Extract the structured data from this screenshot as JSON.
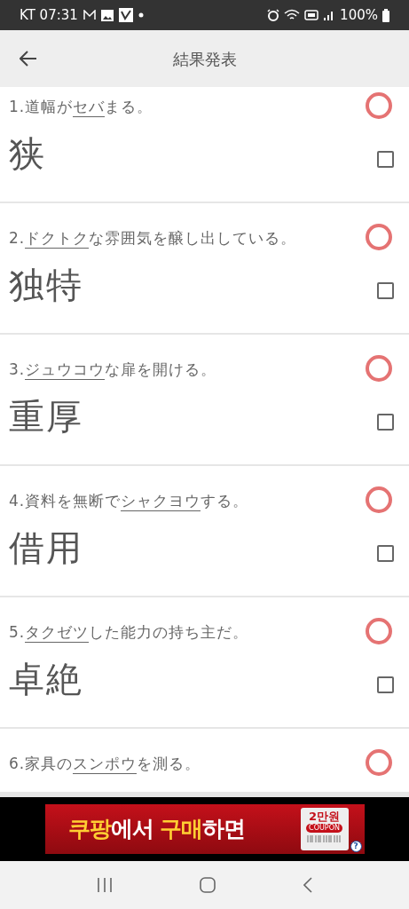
{
  "status_bar": {
    "left_text": "KT 07:31",
    "battery_text": "100%"
  },
  "header": {
    "title": "結果発表"
  },
  "questions": [
    {
      "number": "1.",
      "parts": [
        {
          "text": "道幅が",
          "underline": false
        },
        {
          "text": "セバ",
          "underline": true
        },
        {
          "text": "まる。",
          "underline": false
        }
      ],
      "answer": "狭",
      "correct": true,
      "checked": false
    },
    {
      "number": "2.",
      "parts": [
        {
          "text": "ドクトク",
          "underline": true
        },
        {
          "text": "な雰囲気を醸し出している。",
          "underline": false
        }
      ],
      "answer": "独特",
      "correct": true,
      "checked": false
    },
    {
      "number": "3.",
      "parts": [
        {
          "text": "ジュウコウ",
          "underline": true
        },
        {
          "text": "な扉を開ける。",
          "underline": false
        }
      ],
      "answer": "重厚",
      "correct": true,
      "checked": false
    },
    {
      "number": "4.",
      "parts": [
        {
          "text": "資料を無断で",
          "underline": false
        },
        {
          "text": "シャクヨウ",
          "underline": true
        },
        {
          "text": "する。",
          "underline": false
        }
      ],
      "answer": "借用",
      "correct": true,
      "checked": false
    },
    {
      "number": "5.",
      "parts": [
        {
          "text": "タクゼツ",
          "underline": true
        },
        {
          "text": "した能力の持ち主だ。",
          "underline": false
        }
      ],
      "answer": "卓絶",
      "correct": true,
      "checked": false
    },
    {
      "number": "6.",
      "parts": [
        {
          "text": "家具の",
          "underline": false
        },
        {
          "text": "スンポウ",
          "underline": true
        },
        {
          "text": "を測る。",
          "underline": false
        }
      ],
      "correct": true
    }
  ],
  "ad": {
    "headline": [
      {
        "text": "쿠팡",
        "highlight": true
      },
      {
        "text": "에서 ",
        "highlight": false
      },
      {
        "text": "구매",
        "highlight": true
      },
      {
        "text": "하면",
        "highlight": false
      }
    ],
    "coupon_amount": "2만원",
    "coupon_label": "COUPON",
    "help": "?"
  }
}
